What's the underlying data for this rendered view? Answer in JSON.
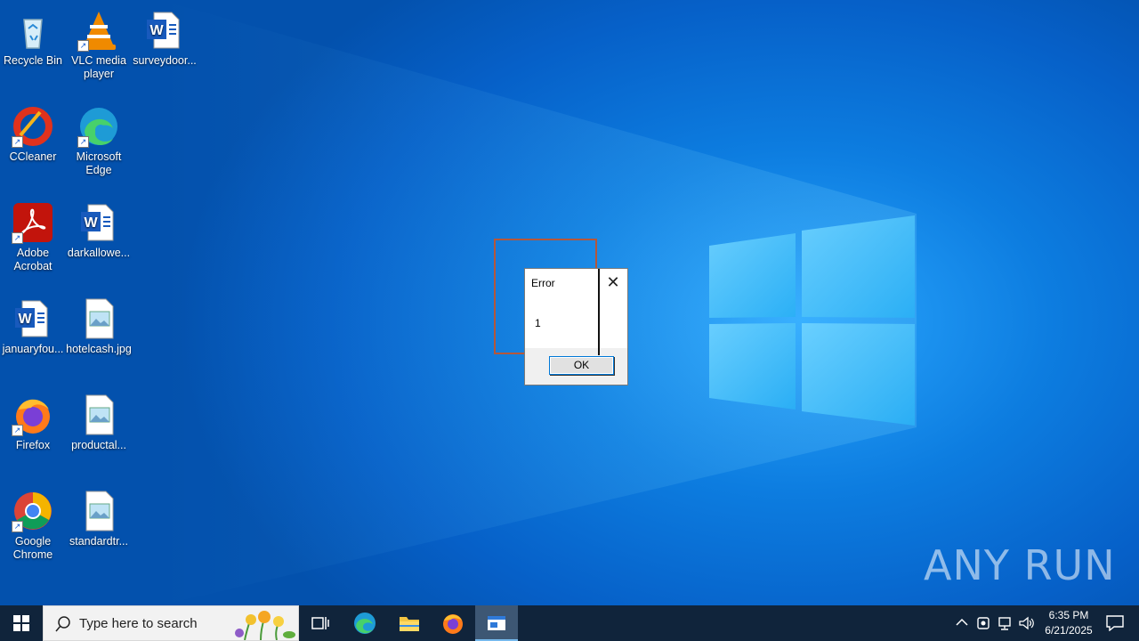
{
  "desktop_icons": [
    {
      "label": "Recycle Bin",
      "icon": "recycle-bin-icon"
    },
    {
      "label": "VLC media player",
      "icon": "vlc-icon"
    },
    {
      "label": "surveydoor...",
      "icon": "word-document-icon"
    },
    {
      "label": "CCleaner",
      "icon": "ccleaner-icon"
    },
    {
      "label": "Microsoft Edge",
      "icon": "edge-icon"
    },
    {
      "label": "Adobe Acrobat",
      "icon": "acrobat-icon"
    },
    {
      "label": "darkallowe...",
      "icon": "word-document-icon"
    },
    {
      "label": "januaryfou...",
      "icon": "word-document-icon"
    },
    {
      "label": "hotelcash.jpg",
      "icon": "image-file-icon"
    },
    {
      "label": "Firefox",
      "icon": "firefox-icon"
    },
    {
      "label": "productal...",
      "icon": "image-file-icon"
    },
    {
      "label": "Google Chrome",
      "icon": "chrome-icon"
    },
    {
      "label": "standardtr...",
      "icon": "image-file-icon"
    }
  ],
  "dialog": {
    "title": "Error",
    "message": "1",
    "ok_label": "OK",
    "close_glyph": "✕"
  },
  "watermark": "ANY RUN",
  "taskbar": {
    "search_placeholder": "Type here to search",
    "clock_time": "6:35 PM",
    "clock_date": "6/21/2025"
  },
  "colors": {
    "desktop_blue": "#0a6fd8",
    "taskbar": "#10243b",
    "selection_rect": "#b5573a"
  }
}
